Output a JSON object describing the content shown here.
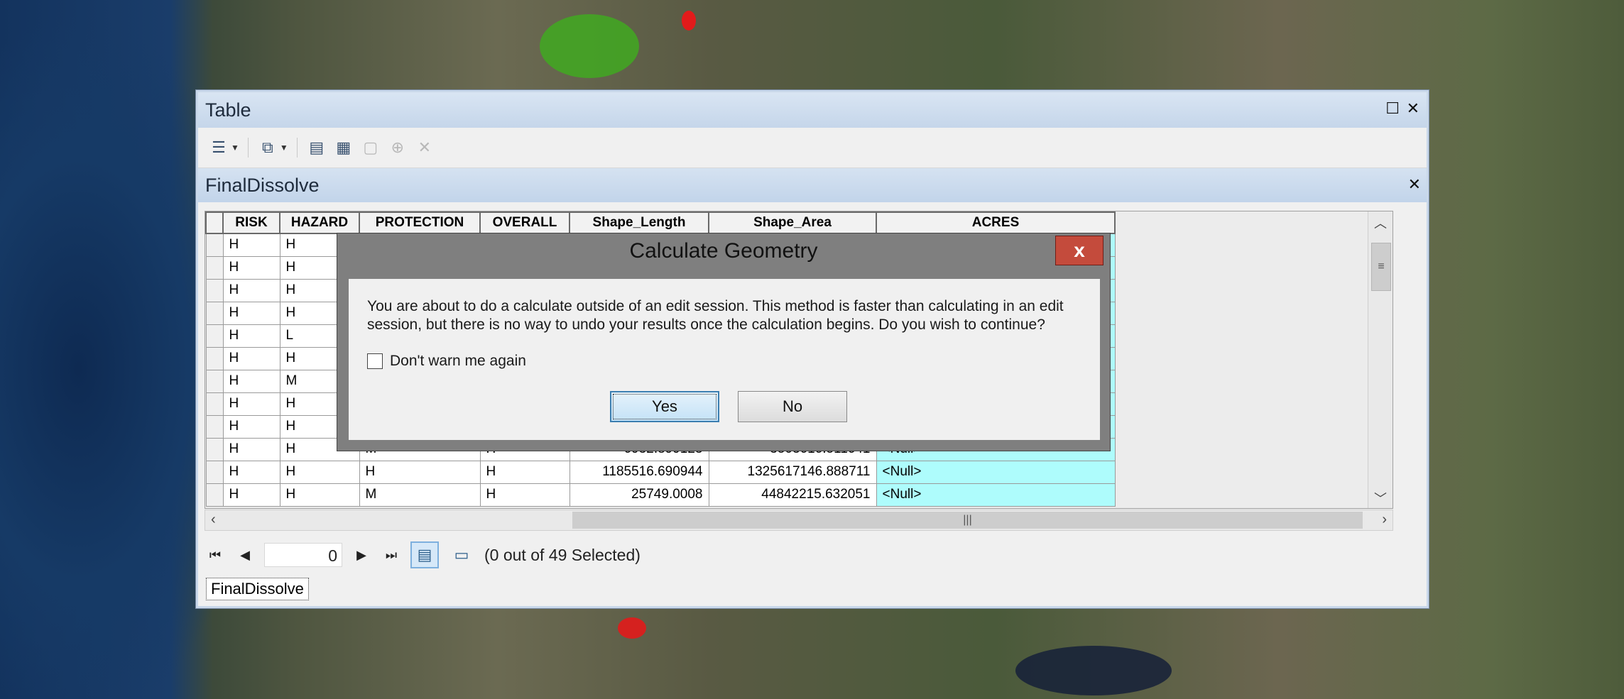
{
  "window": {
    "title": "Table"
  },
  "tab": {
    "title": "FinalDissolve"
  },
  "grid": {
    "columns": [
      "RISK",
      "HAZARD",
      "PROTECTION",
      "OVERALL",
      "Shape_Length",
      "Shape_Area",
      "ACRES"
    ],
    "rows": [
      [
        "H",
        "H",
        "",
        "",
        "",
        "",
        ""
      ],
      [
        "H",
        "H",
        "",
        "",
        "",
        "",
        ""
      ],
      [
        "H",
        "H",
        "",
        "",
        "",
        "",
        ""
      ],
      [
        "H",
        "H",
        "",
        "",
        "",
        "",
        ""
      ],
      [
        "H",
        "L",
        "",
        "",
        "",
        "",
        ""
      ],
      [
        "H",
        "H",
        "",
        "",
        "",
        "",
        ""
      ],
      [
        "H",
        "M",
        "",
        "",
        "",
        "",
        ""
      ],
      [
        "H",
        "H",
        "",
        "",
        "",
        "",
        ""
      ],
      [
        "H",
        "H",
        "",
        "",
        "",
        "",
        ""
      ],
      [
        "H",
        "H",
        "M",
        "H",
        "6932.899123",
        "3503616.511641",
        "<Null>"
      ],
      [
        "H",
        "H",
        "H",
        "H",
        "1185516.690944",
        "1325617146.888711",
        "<Null>"
      ],
      [
        "H",
        "H",
        "M",
        "H",
        "25749.0008",
        "44842215.632051",
        "<Null>"
      ]
    ]
  },
  "nav": {
    "record": "0",
    "status": "(0 out of 49 Selected)"
  },
  "bottom_tab": "FinalDissolve",
  "dialog": {
    "title": "Calculate Geometry",
    "close": "x",
    "message": "You are about to do a calculate outside of an edit session. This method is faster than calculating in an edit session, but there is no way to undo your results once the calculation begins. Do you wish to continue?",
    "checkbox_label": "Don't warn me again",
    "yes": "Yes",
    "no": "No"
  },
  "colors": {
    "acres_cell": "#aefcfc",
    "title_bar": "#c5d6ea",
    "close_button": "#c44b3c"
  }
}
